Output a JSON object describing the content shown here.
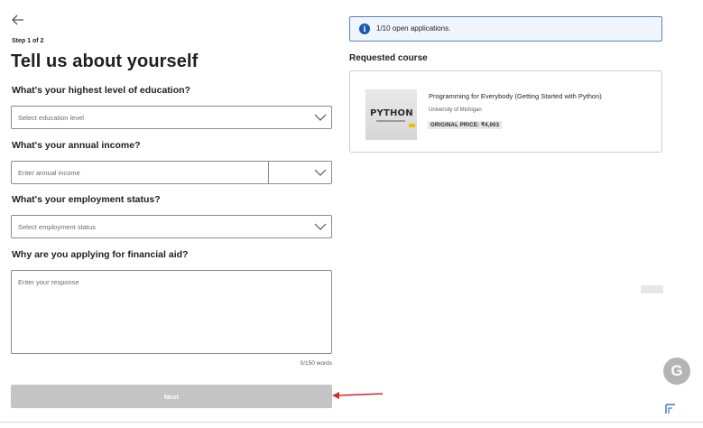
{
  "form": {
    "step": "Step 1 of 2",
    "title": "Tell us about yourself",
    "education": {
      "question": "What's your highest level of education?",
      "placeholder": "Select education level"
    },
    "income": {
      "question": "What's your annual income?",
      "placeholder": "Enter annual income"
    },
    "employment": {
      "question": "What's your employment status?",
      "placeholder": "Select employment status"
    },
    "reason": {
      "question": "Why are you applying for financial aid?",
      "placeholder": "Enter your response",
      "counter": "0/150 words"
    },
    "next_label": "Next"
  },
  "sidebar": {
    "info_text": "1/10 open applications.",
    "requested_title": "Requested course",
    "course": {
      "thumbnail_text": "PYTHON",
      "name": "Programming for Everybody (Getting Started with Python)",
      "university": "University of Michigan",
      "price": "ORIGINAL PRICE: ₹4,003"
    }
  },
  "colors": {
    "accent": "#1a56b8",
    "button_disabled": "#c4c4c4",
    "annotation_arrow": "#d62b2b"
  },
  "icons": [
    "back-arrow-icon",
    "chevron-down-icon",
    "info-icon",
    "grammarly-icon"
  ]
}
